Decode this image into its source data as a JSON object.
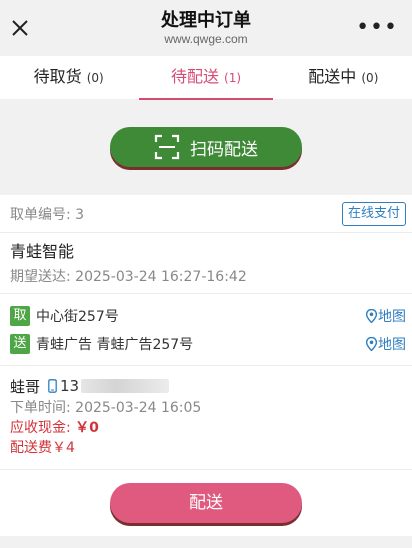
{
  "header": {
    "title": "处理中订单",
    "subtitle": "www.qwge.com",
    "close_icon": "close-icon",
    "more_icon": "more-icon"
  },
  "tabs": [
    {
      "label": "待取货",
      "count": "(0)",
      "active": false
    },
    {
      "label": "待配送",
      "count": "(1)",
      "active": true
    },
    {
      "label": "配送中",
      "count": "(0)",
      "active": false
    }
  ],
  "scan_button": {
    "label": "扫码配送",
    "icon": "scan-icon"
  },
  "order": {
    "pickup_no_label": "取单编号: 3",
    "pay_button": "在线支付",
    "shop_name": "青蛙智能",
    "expected": "期望送达:  2025-03-24 16:27-16:42",
    "pickup": {
      "tag": "取",
      "address": "中心街257号",
      "map": "地图"
    },
    "delivery": {
      "tag": "送",
      "address": "青蛙广告 青蛙广告257号",
      "map": "地图"
    },
    "customer": {
      "name": "蛙哥",
      "phone_prefix": "13"
    },
    "order_time": "下单时间:  2025-03-24 16:05",
    "cash_label": "应收现金: ",
    "cash_value": "￥0",
    "fee": "配送费￥4"
  },
  "deliver_button": "配送",
  "colors": {
    "accent_pink": "#d64a74",
    "green": "#3f8a37",
    "link_blue": "#2f7fc1",
    "red": "#d0343a"
  }
}
